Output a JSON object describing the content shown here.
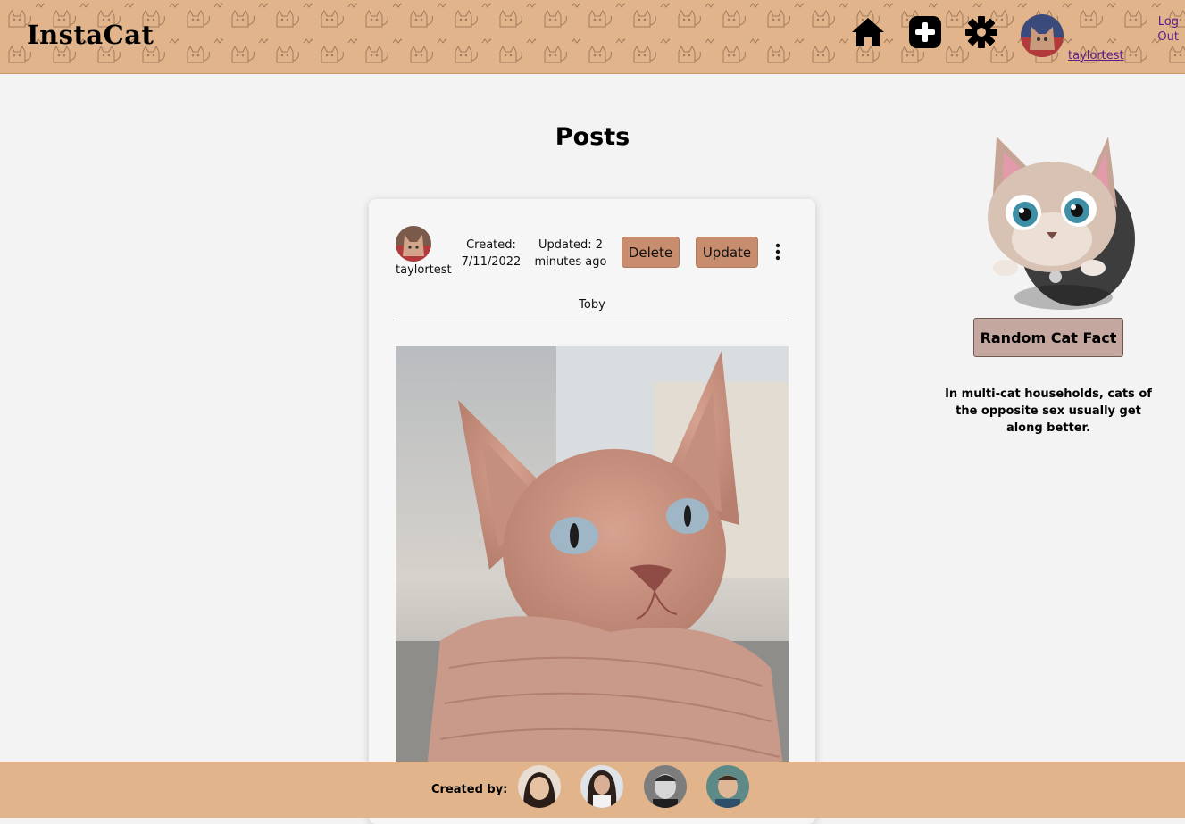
{
  "header": {
    "logo": "InstaCat",
    "username": "taylortest",
    "logout_line1": "Log",
    "logout_line2": "Out",
    "icons": [
      "home-icon",
      "plus-square-icon",
      "gear-icon",
      "user-avatar"
    ]
  },
  "main": {
    "title": "Posts",
    "post": {
      "username": "taylortest",
      "created_label": "Created:",
      "created_date": "7/11/2022",
      "updated_label": "Updated: 2",
      "updated_rel": "minutes ago",
      "delete_label": "Delete",
      "update_label": "Update",
      "caption": "Toby"
    }
  },
  "sidebar": {
    "fact_button": "Random Cat Fact",
    "fact_text": "In multi-cat households, cats of the opposite sex usually get along better."
  },
  "footer": {
    "label": "Created by:",
    "creators": 4
  },
  "colors": {
    "header_bg": "#e2b48b",
    "button_bg": "#c78d6e",
    "fact_button_bg": "#c4a8a0",
    "link": "#5a1e8c",
    "page_bg": "#f3f3f3"
  }
}
